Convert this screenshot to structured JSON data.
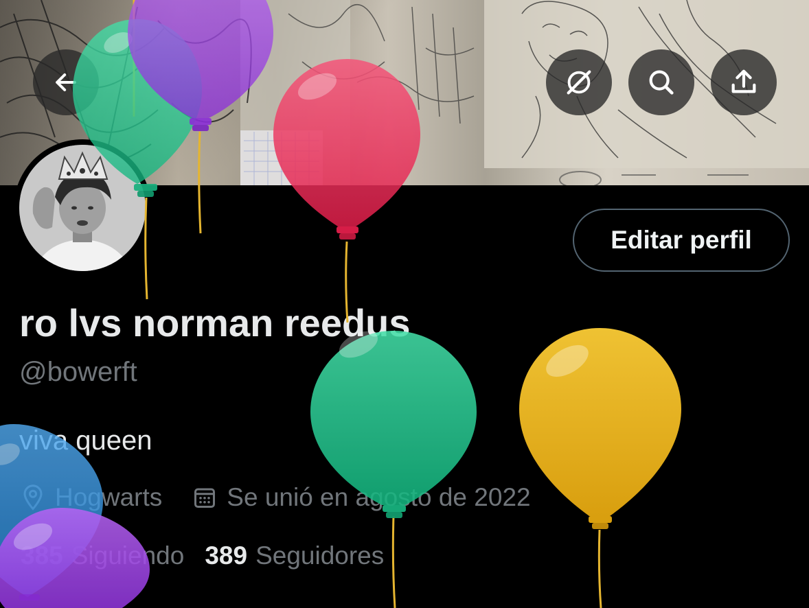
{
  "header": {
    "back_icon": "arrow-left-icon",
    "grok_icon": "grok-icon",
    "search_icon": "search-icon",
    "share_icon": "share-icon"
  },
  "profile": {
    "edit_button": "Editar perfil",
    "display_name": "ro lvs norman reedus",
    "handle": "@bowerft",
    "bio": "viva queen",
    "location": "Hogwarts",
    "joined": "Se unió en agosto de 2022",
    "following_count": "385",
    "following_label": "Siguiendo",
    "followers_count": "389",
    "followers_label": "Seguidores"
  },
  "colors": {
    "background": "#000000",
    "primary_text": "#e7e9ea",
    "secondary_text": "#71767b",
    "balloon_green": "#2fd49a",
    "balloon_purple": "#a348e8",
    "balloon_red": "#f2365e",
    "balloon_yellow": "#e6b21e",
    "balloon_blue": "#3a97e0"
  }
}
